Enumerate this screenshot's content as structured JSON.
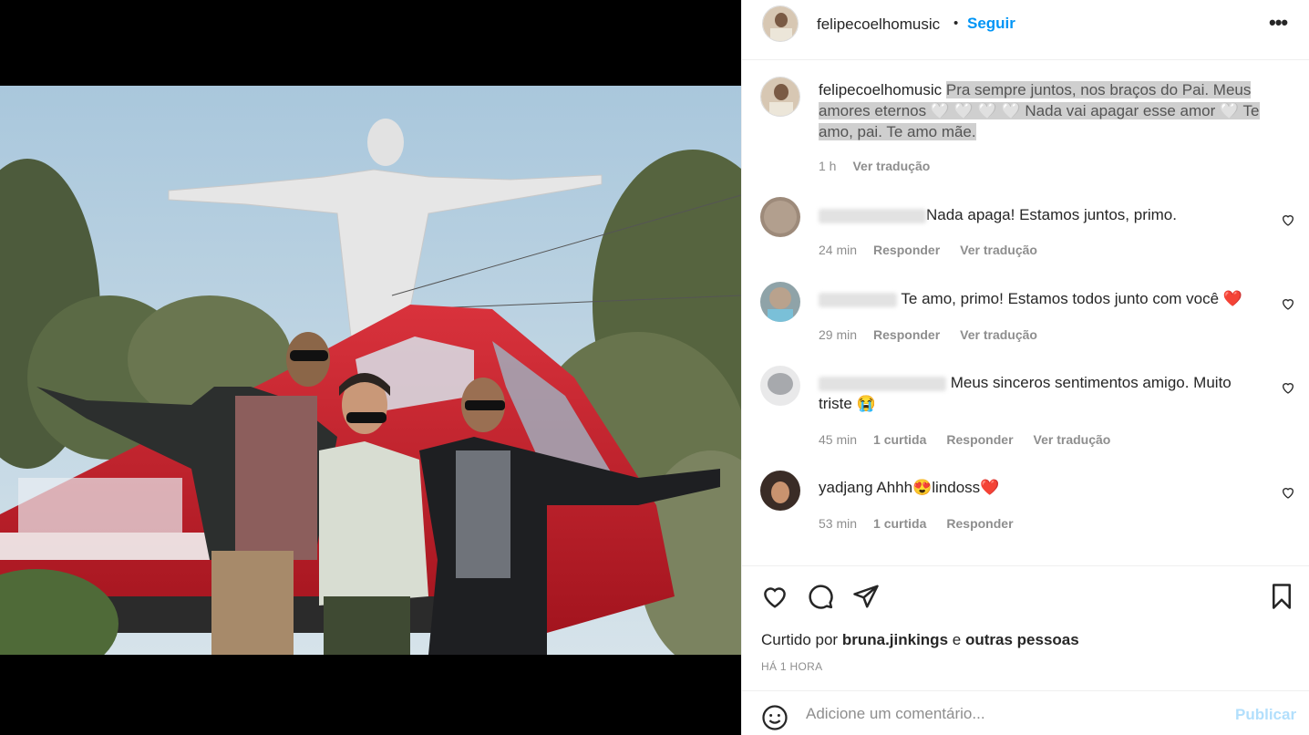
{
  "post": {
    "username": "felipecoelhomusic",
    "dot": "•",
    "follow_label": "Seguir",
    "more_icon": "more-options-icon",
    "more_label": "•••"
  },
  "caption": {
    "username": "felipecoelhomusic",
    "text_1": "Pra sempre juntos, nos braços do Pai. Meus amores eternos 🤍 🤍 🤍 🤍 Nada vai apagar esse amor 🤍  Te amo, pai. Te amo mãe.",
    "time": "1 h",
    "translate": "Ver tradução"
  },
  "comments": [
    {
      "username": "",
      "text": "Nada apaga! Estamos juntos, primo.",
      "time": "24 min",
      "reply": "Responder",
      "translate": "Ver tradução"
    },
    {
      "username": "",
      "text": "Te amo, primo! Estamos todos junto com você",
      "emoji": "❤️",
      "time": "29 min",
      "reply": "Responder",
      "translate": "Ver tradução"
    },
    {
      "username": "",
      "text": "Meus sinceros sentimentos amigo. Muito triste 😭",
      "time": "45 min",
      "likes": "1 curtida",
      "reply": "Responder",
      "translate": "Ver tradução"
    },
    {
      "username": "yadjang",
      "text": "Ahhh😍lindoss❤️",
      "time": "53 min",
      "likes": "1 curtida",
      "reply": "Responder"
    }
  ],
  "actions": {
    "liked_by_prefix": "Curtido por",
    "liked_by_user": "bruna.jinkings",
    "liked_by_and": "e",
    "liked_by_others": "outras pessoas",
    "post_time": "HÁ 1 HORA"
  },
  "add_comment": {
    "placeholder": "Adicione um comentário...",
    "publish_label": "Publicar"
  },
  "colors": {
    "follow_blue": "#0095f6",
    "publish_disabled": "#b2dffc",
    "meta_grey": "#8e8e8e",
    "train_red": "#c81e2a",
    "sky": "#b9d3e3"
  }
}
